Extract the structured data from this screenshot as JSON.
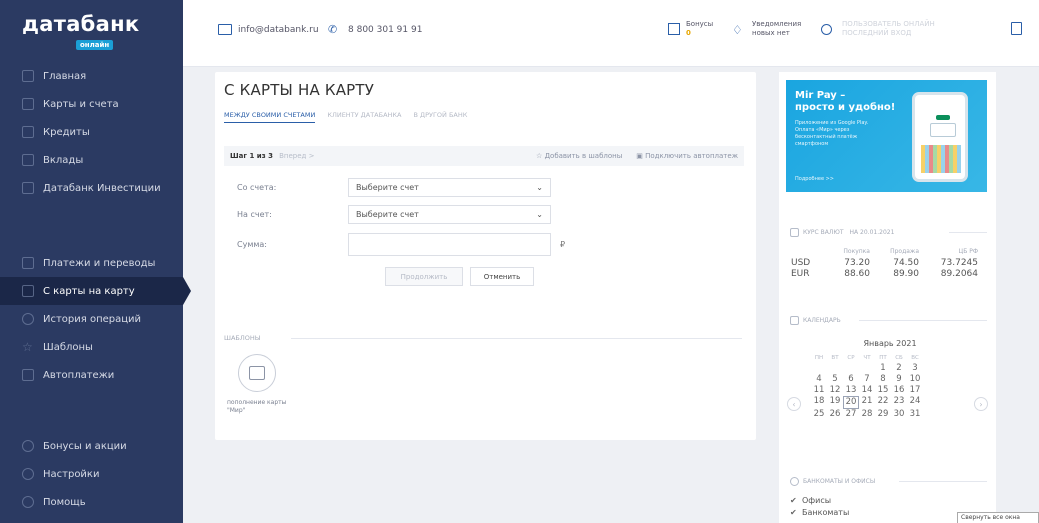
{
  "app": {
    "logo_text": "датабанк",
    "logo_sub": "онлайн"
  },
  "sidebar": {
    "items_top": [
      {
        "label": "Главная",
        "icon": "home-icon"
      },
      {
        "label": "Карты и счета",
        "icon": "cards-icon"
      },
      {
        "label": "Кредиты",
        "icon": "credit-icon"
      },
      {
        "label": "Вклады",
        "icon": "deposit-icon"
      },
      {
        "label": "Датабанк Инвестиции",
        "icon": "invest-icon"
      }
    ],
    "items_mid": [
      {
        "label": "Платежи и переводы",
        "icon": "payments-icon"
      },
      {
        "label": "С карты на карту",
        "icon": "card-transfer-icon",
        "active": true
      },
      {
        "label": "История операций",
        "icon": "history-icon"
      },
      {
        "label": "Шаблоны",
        "icon": "star-icon"
      },
      {
        "label": "Автоплатежи",
        "icon": "autopay-icon"
      }
    ],
    "items_bottom": [
      {
        "label": "Бонусы и акции",
        "icon": "bonus-icon"
      },
      {
        "label": "Настройки",
        "icon": "gear-icon"
      },
      {
        "label": "Помощь",
        "icon": "help-icon"
      }
    ]
  },
  "header": {
    "email": "info@databank.ru",
    "phone": "8 800 301 91 91",
    "bonus_label": "Бонусы",
    "bonus_value": "0",
    "notif_label": "Уведомления",
    "notif_value": "новых нет",
    "user_line1": "ПОЛЬЗОВАТЕЛЬ ОНЛАЙН",
    "user_line2": "ПОСЛЕДНИЙ ВХОД"
  },
  "main": {
    "title": "С карты на карту",
    "tabs": [
      "Между своими счетами",
      "Клиенту Датабанка",
      "В другой банк"
    ],
    "step": "Шаг 1 из 3",
    "next": "Вперед >",
    "add_template": "Добавить в шаблоны",
    "connect_autopay": "Подключить автоплатеж",
    "from_label": "Со счета:",
    "to_label": "На счет:",
    "amount_label": "Сумма:",
    "select_placeholder": "Выберите счет",
    "currency": "₽",
    "continue_btn": "Продолжить",
    "cancel_btn": "Отменить",
    "templates_title": "Шаблоны",
    "template_item": "пополнение карты \"Мир\""
  },
  "right": {
    "banner_title": "Mir Pay –\nпросто и удобно!",
    "banner_text": "Приложение из Google Play. Оплата «Мир» через бесконтактный платёж смартфоном",
    "banner_more": "Подробнее >>",
    "rates_title": "Курс валют",
    "rates_date": "на 20.01.2021",
    "rates_headers": [
      "",
      "Покупка",
      "Продажа",
      "ЦБ РФ"
    ],
    "rates": [
      [
        "USD",
        "73.20",
        "74.50",
        "73.7245"
      ],
      [
        "EUR",
        "88.60",
        "89.90",
        "89.2064"
      ]
    ],
    "calendar_title": "Календарь",
    "calendar_month": "Январь 2021",
    "weekdays": [
      "ПН",
      "ВТ",
      "СР",
      "ЧТ",
      "ПТ",
      "СБ",
      "ВС"
    ],
    "weeks": [
      [
        "",
        "",
        "",
        "",
        "1",
        "2",
        "3"
      ],
      [
        "4",
        "5",
        "6",
        "7",
        "8",
        "9",
        "10"
      ],
      [
        "11",
        "12",
        "13",
        "14",
        "15",
        "16",
        "17"
      ],
      [
        "18",
        "19",
        "20",
        "21",
        "22",
        "23",
        "24"
      ],
      [
        "25",
        "26",
        "27",
        "28",
        "29",
        "30",
        "31"
      ]
    ],
    "today": "20",
    "offices_title": "Банкоматы и офисы",
    "offices": [
      "Офисы",
      "Банкоматы"
    ],
    "tooltip": "Свернуть все окна"
  }
}
